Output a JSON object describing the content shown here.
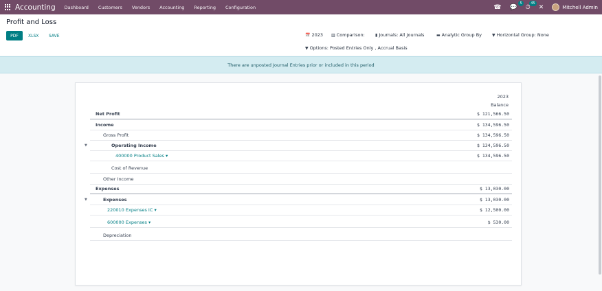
{
  "navbar": {
    "brand": "Accounting",
    "menu": [
      "Dashboard",
      "Customers",
      "Vendors",
      "Accounting",
      "Reporting",
      "Configuration"
    ],
    "chat_badge": "5",
    "activity_badge": "45",
    "user_name": "Mitchell Admin"
  },
  "control": {
    "title": "Profit and Loss",
    "buttons": {
      "pdf": "PDF",
      "xlsx": "XLSX",
      "save": "SAVE"
    },
    "filters": {
      "date": "2023",
      "comparison": "Comparison:",
      "journals": "Journals: All Journals",
      "analytic": "Analytic Group By",
      "horizontal": "Horizontal Group: None",
      "options": "Options: Posted Entries Only , Accrual Basis"
    }
  },
  "alert": {
    "message": "There are unposted Journal Entries prior or included in this period"
  },
  "report": {
    "column_year": "2023",
    "column_label": "Balance",
    "rows": [
      {
        "label": "Net Profit",
        "value": "$ 121,566.50"
      },
      {
        "label": "Income",
        "value": "$ 134,596.50"
      },
      {
        "label": "Gross Profit",
        "value": "$ 134,596.50"
      },
      {
        "label": "Operating Income",
        "value": "$ 134,596.50"
      },
      {
        "label": "400000 Product Sales",
        "value": "$ 134,596.50"
      },
      {
        "label": "Cost of Revenue",
        "value": ""
      },
      {
        "label": "Other Income",
        "value": ""
      },
      {
        "label": "Expenses",
        "value": "$ 13,030.00"
      },
      {
        "label": "Expenses",
        "value": "$ 13,030.00"
      },
      {
        "label": "220010 Expenses IC",
        "value": "$ 12,500.00"
      },
      {
        "label": "600000 Expenses",
        "value": "$ 530.00"
      },
      {
        "label": "Depreciation",
        "value": ""
      }
    ]
  }
}
